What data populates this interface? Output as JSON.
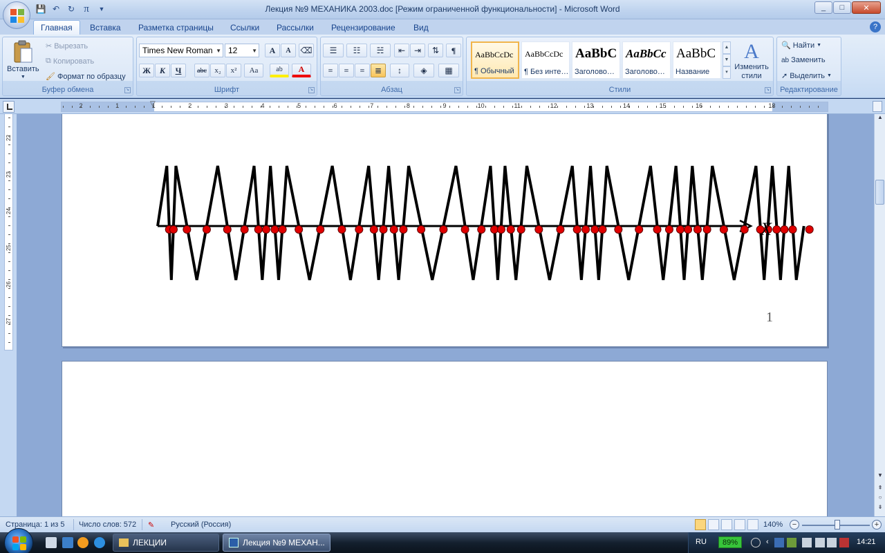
{
  "window": {
    "title": "Лекция №9 МЕХАНИКА 2003.doc [Режим ограниченной функциональности] - Microsoft Word",
    "controls": {
      "minimize": "_",
      "maximize": "□",
      "close": "✕"
    }
  },
  "qat": {
    "save": "💾",
    "undo": "↶",
    "redo": "↻",
    "pi": "π"
  },
  "tabs": [
    "Главная",
    "Вставка",
    "Разметка страницы",
    "Ссылки",
    "Рассылки",
    "Рецензирование",
    "Вид"
  ],
  "ribbon": {
    "clipboard": {
      "label": "Буфер обмена",
      "paste": "Вставить",
      "cut": "Вырезать",
      "copy": "Копировать",
      "format_painter": "Формат по образцу"
    },
    "font": {
      "label": "Шрифт",
      "font_name": "Times New Roman",
      "font_size": "12",
      "grow": "A",
      "shrink": "A",
      "bold": "Ж",
      "italic": "К",
      "underline": "Ч",
      "strike": "abc",
      "subscript": "x₂",
      "superscript": "x²",
      "case": "Aa",
      "highlight": "ab",
      "color": "A"
    },
    "paragraph": {
      "label": "Абзац",
      "pilcrow": "¶"
    },
    "styles": {
      "label": "Стили",
      "items": [
        {
          "sample": "AaBbCcDc",
          "name": "¶ Обычный"
        },
        {
          "sample": "AaBbCcDc",
          "name": "¶ Без инте…"
        },
        {
          "sample": "AaBbC",
          "name": "Заголово…"
        },
        {
          "sample": "AaBbCc",
          "name": "Заголово…"
        },
        {
          "sample": "AaBbC",
          "name": "Название"
        }
      ],
      "change": "Изменить стили"
    },
    "editing": {
      "label": "Редактирование",
      "find": "Найти",
      "replace": "Заменить",
      "select": "Выделить"
    }
  },
  "ruler": {
    "h_labels": [
      "2",
      "1",
      "1",
      "2",
      "3",
      "4",
      "5",
      "6",
      "7",
      "8",
      "9",
      "10",
      "11",
      "12",
      "13",
      "14",
      "15",
      "16",
      "18"
    ],
    "v_labels": [
      "22",
      "23",
      "24",
      "25",
      "26",
      "27"
    ]
  },
  "document": {
    "axis_label": "X",
    "page_number": "1",
    "figure": {
      "upper_peaks_x_cm": [
        0.1,
        0.35,
        1.5,
        2.5,
        2.95,
        3.4,
        4.65,
        5.65,
        6.2,
        6.75,
        8.05,
        9.0,
        9.4,
        10.0,
        11.25,
        11.75,
        12.2,
        13.4,
        14.1,
        14.55,
        15.1,
        16.3,
        16.75,
        17.2
      ],
      "red_dots_count": 44
    }
  },
  "statusbar": {
    "page": "Страница: 1 из 5",
    "words": "Число слов: 572",
    "language": "Русский (Россия)",
    "zoom": "140%"
  },
  "taskbar": {
    "tasks": [
      {
        "label": "ЛЕКЦИИ"
      },
      {
        "label": "Лекция №9 МЕХАН..."
      }
    ],
    "lang": "RU",
    "battery": "89%",
    "time": "14:21"
  }
}
